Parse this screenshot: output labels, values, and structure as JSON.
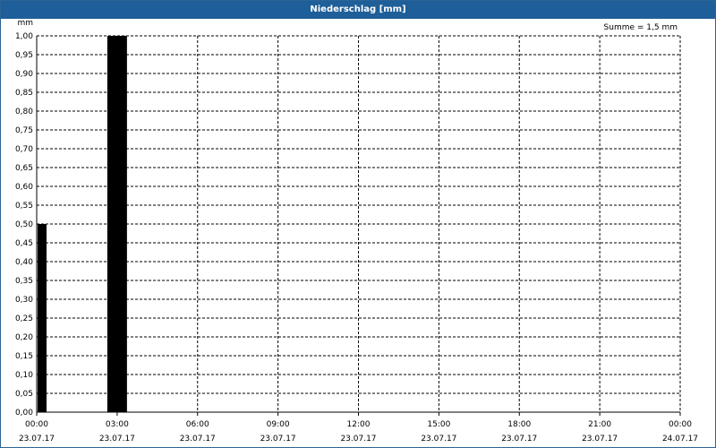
{
  "window": {
    "title": "Niederschlag [mm]"
  },
  "summary": {
    "text": "Summe = 1,5 mm"
  },
  "chart_data": {
    "type": "bar",
    "title": "Niederschlag [mm]",
    "ylabel": "mm",
    "xlabel": "",
    "ylim": [
      0,
      1.0
    ],
    "yticks": [
      "0,00",
      "0,05",
      "0,10",
      "0,15",
      "0,20",
      "0,25",
      "0,30",
      "0,35",
      "0,40",
      "0,45",
      "0,50",
      "0,55",
      "0,60",
      "0,65",
      "0,70",
      "0,75",
      "0,80",
      "0,85",
      "0,90",
      "0,95",
      "1,00"
    ],
    "xlim_hours": [
      0,
      24
    ],
    "xticks": [
      {
        "time": "00:00",
        "date": "23.07.17"
      },
      {
        "time": "03:00",
        "date": "23.07.17"
      },
      {
        "time": "06:00",
        "date": "23.07.17"
      },
      {
        "time": "09:00",
        "date": "23.07.17"
      },
      {
        "time": "12:00",
        "date": "23.07.17"
      },
      {
        "time": "15:00",
        "date": "23.07.17"
      },
      {
        "time": "18:00",
        "date": "23.07.17"
      },
      {
        "time": "21:00",
        "date": "23.07.17"
      },
      {
        "time": "00:00",
        "date": "24.07.17"
      }
    ],
    "bars": [
      {
        "time": "00:00",
        "value": 0.5
      },
      {
        "time": "03:00",
        "value": 1.0
      }
    ],
    "grid": true,
    "bar_color": "#000000",
    "grid_color": "#000000"
  }
}
